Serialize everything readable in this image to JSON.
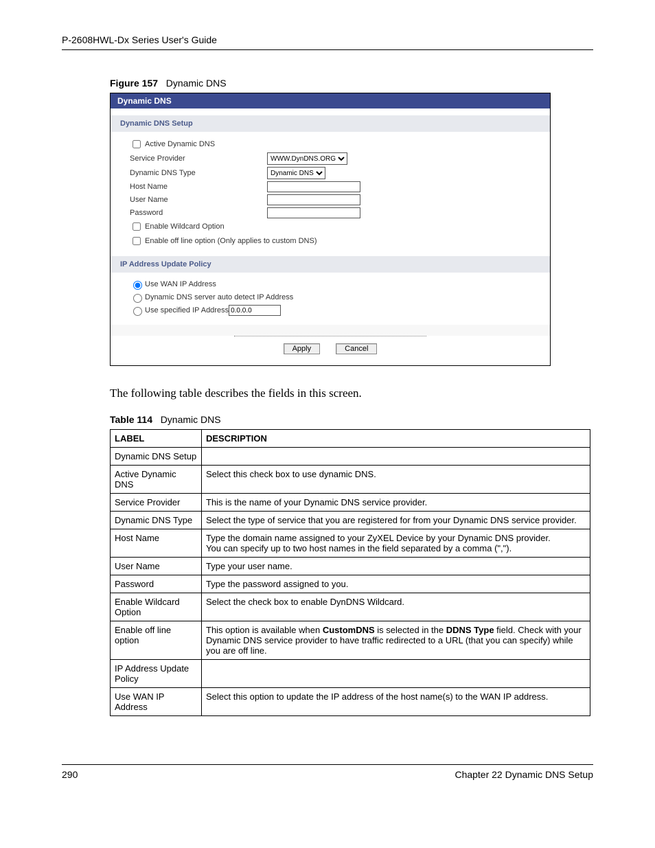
{
  "header": {
    "title": "P-2608HWL-Dx Series User's Guide"
  },
  "figure": {
    "label": "Figure 157",
    "title": "Dynamic DNS"
  },
  "screenshot": {
    "titlebar": "Dynamic DNS",
    "section1": "Dynamic DNS Setup",
    "active_dns_label": "Active Dynamic DNS",
    "service_provider_label": "Service Provider",
    "service_provider_value": "WWW.DynDNS.ORG",
    "dns_type_label": "Dynamic DNS Type",
    "dns_type_value": "Dynamic DNS",
    "host_name_label": "Host Name",
    "user_name_label": "User Name",
    "password_label": "Password",
    "wildcard_label": "Enable Wildcard Option",
    "offline_label": "Enable off line option (Only applies to custom DNS)",
    "section2": "IP Address Update Policy",
    "radio_wan": "Use WAN IP Address",
    "radio_auto": "Dynamic DNS server auto detect IP Address",
    "radio_spec": "Use specified IP Address",
    "spec_ip_value": "0.0.0.0",
    "apply": "Apply",
    "cancel": "Cancel"
  },
  "body_text": "The following table describes the fields in this screen.",
  "table_caption": {
    "label": "Table 114",
    "title": "Dynamic DNS"
  },
  "table": {
    "header_label": "LABEL",
    "header_desc": "DESCRIPTION",
    "rows": [
      {
        "label": "Dynamic DNS Setup",
        "desc": ""
      },
      {
        "label": "Active Dynamic DNS",
        "desc": "Select this check box to use dynamic DNS."
      },
      {
        "label": "Service Provider",
        "desc": "This is the name of your Dynamic DNS service provider."
      },
      {
        "label": "Dynamic DNS Type",
        "desc": "Select the type of service that you are registered for from your Dynamic DNS service provider."
      },
      {
        "label": "Host Name",
        "desc": "Type the domain name assigned to your ZyXEL Device by your Dynamic DNS provider.\nYou can specify up to two host names in the field separated by a comma (\",\")."
      },
      {
        "label": "User Name",
        "desc": "Type your user name."
      },
      {
        "label": "Password",
        "desc": "Type the password assigned to you."
      },
      {
        "label": "Enable Wildcard Option",
        "desc": "Select the check box to enable DynDNS Wildcard."
      },
      {
        "label": "Enable off line option",
        "desc": "This option is available when CustomDNS is selected in the DDNS Type field. Check with your Dynamic DNS service provider to have traffic redirected to a URL (that you can specify) while you are off line."
      },
      {
        "label": "IP Address Update Policy",
        "desc": ""
      },
      {
        "label": "Use WAN IP Address",
        "desc": "Select this option to update the IP address of the host name(s) to the WAN IP address."
      }
    ]
  },
  "footer": {
    "page": "290",
    "chapter": "Chapter 22 Dynamic DNS Setup"
  }
}
